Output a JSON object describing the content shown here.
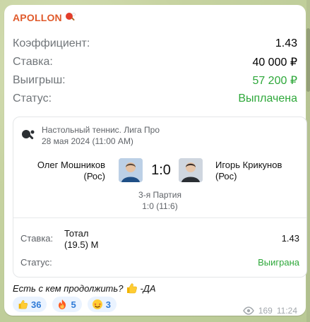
{
  "message": {
    "sender": "APOLLON",
    "sender_emoji": "table-tennis-paddle",
    "fields": [
      {
        "label": "Коэффициент:",
        "value": "1.43",
        "value_color": "black"
      },
      {
        "label": "Ставка:",
        "value": "40 000 ₽",
        "value_color": "black"
      },
      {
        "label": "Выигрыш:",
        "value": "57 200 ₽",
        "value_color": "green"
      },
      {
        "label": "Статус:",
        "value": "Выплачена",
        "value_color": "green"
      }
    ],
    "card": {
      "league": "Настольный теннис. Лига Про",
      "date": "28 мая 2024 (11:00 AM)",
      "team_left": {
        "name": "Олег Мошников",
        "country": "(Рос)"
      },
      "team_right": {
        "name": "Игорь Крикунов",
        "country": "(Рос)"
      },
      "score": "1:0",
      "period": "3-я Партия",
      "period_score": "1:0 (11:6)",
      "bet": {
        "label": "Ставка:",
        "market_line1": "Тотал",
        "market_line2": "(19.5) М",
        "odds": "1.43"
      },
      "status": {
        "label": "Статус:",
        "value": "Выиграна"
      }
    },
    "caption_text": "Есть с кем продолжить?",
    "caption_suffix": "-ДА",
    "reactions": [
      {
        "icon": "thumbs-up",
        "count": "36"
      },
      {
        "icon": "fire",
        "count": "5"
      },
      {
        "icon": "star-struck",
        "count": "3"
      }
    ],
    "views": "169",
    "time": "11:24"
  },
  "colors": {
    "sender": "#e05a2b",
    "green": "#2ea83a",
    "muted": "#707579",
    "reaction_bg": "#eaf3ff",
    "reaction_text": "#2f7bd7"
  }
}
